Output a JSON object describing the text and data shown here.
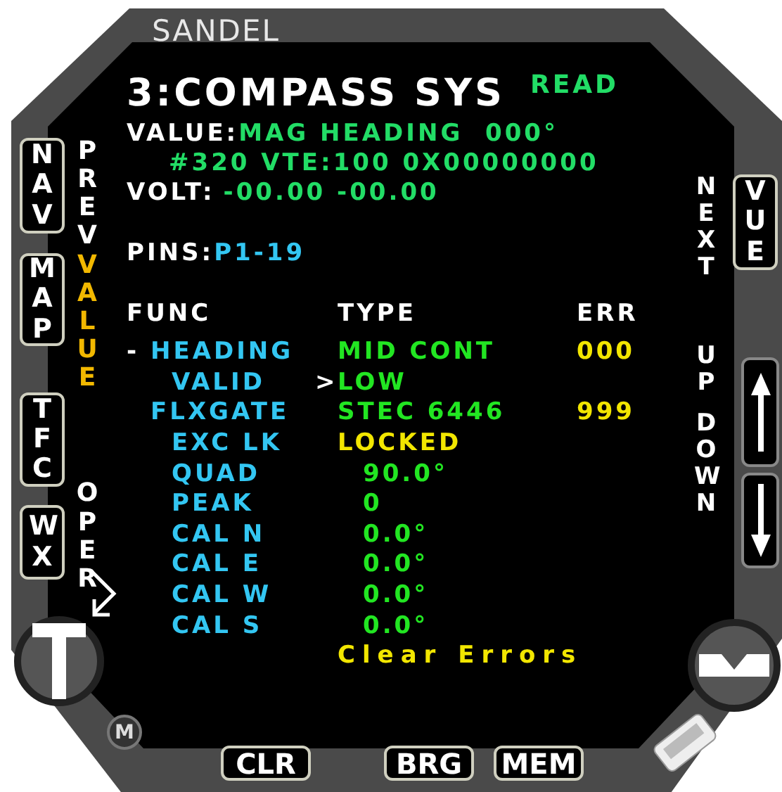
{
  "brand": "SANDEL",
  "bezel_keys_left": [
    "NAV",
    "MAP",
    "TFC",
    "WX"
  ],
  "bezel_key_right": "VUE",
  "bezel_keys_bottom": [
    "CLR",
    "BRG",
    "MEM"
  ],
  "knob_label": "M",
  "screen": {
    "title": "3:COMPASS SYS",
    "mode": "READ",
    "value_line": {
      "label": "VALUE:",
      "text": "MAG HEADING  000°"
    },
    "detail": "#320 VTE:100 0X00000000",
    "volt": {
      "label": "VOLT:",
      "text": "-00.00 -00.00"
    },
    "pins": {
      "label": "PINS:",
      "text": "P1-19"
    },
    "soft_left": [
      {
        "label": "PREV",
        "selected": false
      },
      {
        "label": "VALUE",
        "selected": true
      },
      {
        "label": "OPER",
        "selected": false
      }
    ],
    "soft_right": [
      "NEXT",
      "UP",
      "DOWN"
    ],
    "columns": [
      "FUNC",
      "TYPE",
      "ERR"
    ],
    "rows": [
      {
        "func": "HEADING",
        "marker": "-",
        "type": "MID CONT",
        "kind": "mode",
        "err": "000",
        "color": "#22e622",
        "children": [
          {
            "func": "VALID",
            "cursor": ">",
            "type": "LOW",
            "kind": "mode",
            "color": "#22e622"
          }
        ]
      },
      {
        "func": "FLXGATE",
        "type": "STEC 6446",
        "kind": "mode",
        "err": "999",
        "color": "#22e622",
        "children": [
          {
            "func": "EXC LK",
            "type": "LOCKED",
            "kind": "mode",
            "color": "#f2e600"
          },
          {
            "func": "QUAD",
            "type": "90.0°",
            "kind": "reading",
            "color": "#22e622"
          },
          {
            "func": "PEAK",
            "type": "0",
            "kind": "reading",
            "color": "#22e622"
          },
          {
            "func": "CAL N",
            "type": "0.0°",
            "kind": "reading",
            "color": "#22e622"
          },
          {
            "func": "CAL E",
            "type": "0.0°",
            "kind": "reading",
            "color": "#22e622"
          },
          {
            "func": "CAL W",
            "type": "0.0°",
            "kind": "reading",
            "color": "#22e622"
          },
          {
            "func": "CAL S",
            "type": "0.0°",
            "kind": "reading",
            "color": "#22e622"
          }
        ]
      }
    ],
    "action": "Clear Errors"
  }
}
